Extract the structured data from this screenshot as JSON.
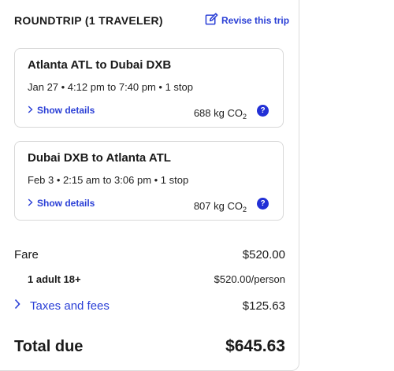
{
  "header": {
    "title": "ROUNDTRIP (1 TRAVELER)",
    "revise_label": "Revise this trip"
  },
  "segments": [
    {
      "route": "Atlanta ATL to Dubai DXB",
      "info": "Jan 27 • 4:12 pm to 7:40 pm • 1 stop",
      "show_label": "Show details",
      "co2_value": "688 kg CO",
      "co2_sub": "2",
      "help": "?"
    },
    {
      "route": "Dubai DXB to Atlanta ATL",
      "info": "Feb 3 • 2:15 am to 3:06 pm • 1 stop",
      "show_label": "Show details",
      "co2_value": "807 kg CO",
      "co2_sub": "2",
      "help": "?"
    }
  ],
  "price": {
    "fare_label": "Fare",
    "fare_value": "$520.00",
    "adult_label": "1 adult 18+",
    "adult_value": "$520.00/person",
    "taxes_label": "Taxes and fees",
    "taxes_value": "$125.63",
    "total_label": "Total due",
    "total_value": "$645.63"
  },
  "colors": {
    "accent": "#2a3fd6",
    "help_badge": "#2230d6"
  },
  "icons": {
    "revise": "edit-icon",
    "expand": "chevron-right-icon",
    "help": "help-icon"
  }
}
